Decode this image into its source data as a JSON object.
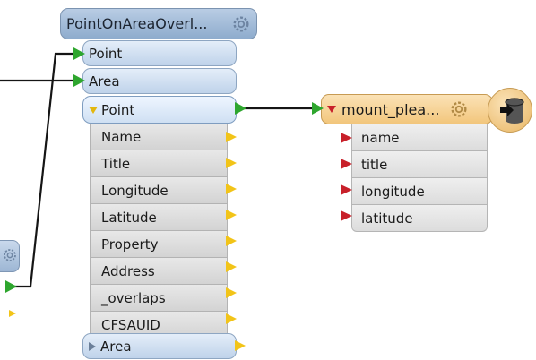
{
  "transformer": {
    "title": "PointOnAreaOverl...",
    "input_ports": [
      "Point",
      "Area"
    ],
    "output_port_point": "Point",
    "attributes": [
      "Name",
      "Title",
      "Longitude",
      "Latitude",
      "Property",
      "Address",
      "_overlaps",
      "CFSAUID"
    ],
    "output_port_area": "Area"
  },
  "writer": {
    "title": "mount_plea...",
    "attributes": [
      "name",
      "title",
      "longitude",
      "latitude"
    ]
  },
  "colors": {
    "transformer_blue": "#b9cde4",
    "writer_orange": "#f2c67c",
    "port_green": "#2ea62e",
    "attr_yellow": "#f2c418",
    "writer_red": "#c8202a"
  }
}
